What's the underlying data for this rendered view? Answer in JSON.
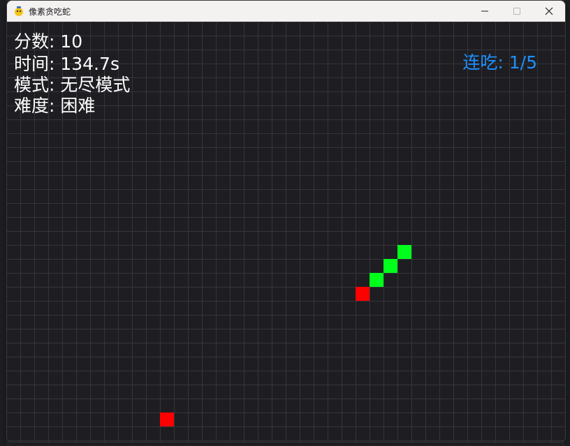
{
  "window": {
    "title": "像素贪吃蛇",
    "controls": {
      "minimize_icon": "minimize-icon",
      "maximize_icon": "maximize-icon",
      "close_icon": "close-icon"
    }
  },
  "hud": {
    "score": "分数: 10",
    "time": "时间: 134.7s",
    "mode": "模式: 无尽模式",
    "difficulty": "难度: 困难",
    "combo": "连吃: 1/5"
  },
  "game": {
    "cell_size": 20,
    "colors": {
      "snake": "#00ff1a",
      "snake_head": "#ff0000",
      "food": "#ff0000",
      "hud_text": "#ffffff",
      "combo_text": "#1e90ff",
      "background": "#1e1e22",
      "grid": "#34343a"
    },
    "snake": [
      {
        "col": 25,
        "row": 19,
        "part": "head"
      },
      {
        "col": 26,
        "row": 18,
        "part": "body"
      },
      {
        "col": 27,
        "row": 17,
        "part": "body"
      },
      {
        "col": 28,
        "row": 16,
        "part": "body"
      }
    ],
    "food": {
      "col": 11,
      "row": 28
    }
  }
}
